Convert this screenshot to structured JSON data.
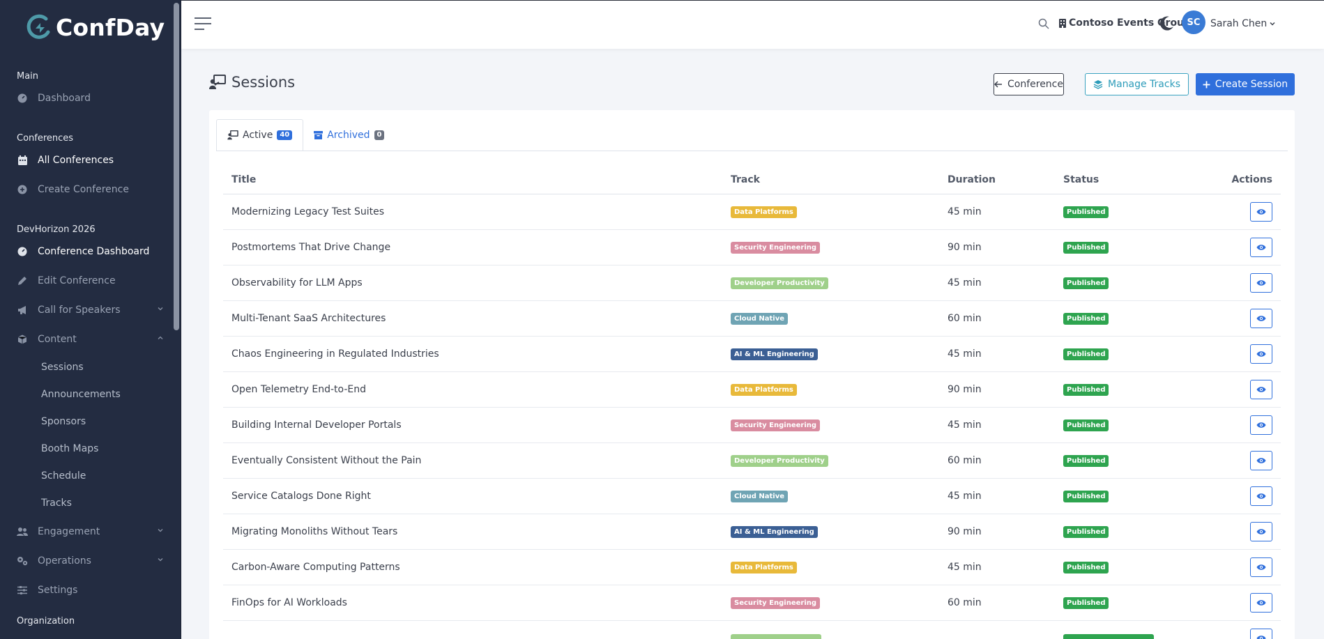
{
  "brand": {
    "name": "ConfDay"
  },
  "header": {
    "org_name": "Contoso Events Group",
    "user_initials": "SC",
    "user_name": "Sarah Chen"
  },
  "sidebar": {
    "sections": {
      "main": "Main",
      "conferences": "Conferences",
      "conference_name": "DevHorizon 2026",
      "organization": "Organization"
    },
    "items": {
      "dashboard": "Dashboard",
      "all_conferences": "All Conferences",
      "create_conference": "Create Conference",
      "conference_dashboard": "Conference Dashboard",
      "edit_conference": "Edit Conference",
      "call_for_speakers": "Call for Speakers",
      "content": "Content",
      "engagement": "Engagement",
      "operations": "Operations",
      "settings": "Settings"
    },
    "content_sub": {
      "sessions": "Sessions",
      "announcements": "Announcements",
      "sponsors": "Sponsors",
      "booth_maps": "Booth Maps",
      "schedule": "Schedule",
      "tracks": "Tracks"
    }
  },
  "page": {
    "title": "Sessions",
    "buttons": {
      "conference": "Conference",
      "manage_tracks": "Manage Tracks",
      "create_session": "Create Session"
    },
    "tabs": {
      "active_label": "Active",
      "active_count": "40",
      "archived_label": "Archived",
      "archived_count": "0"
    },
    "table": {
      "headers": {
        "title": "Title",
        "track": "Track",
        "duration": "Duration",
        "status": "Status",
        "actions": "Actions"
      },
      "rows": [
        {
          "title": "Modernizing Legacy Test Suites",
          "track": "Data Platforms",
          "duration": "45 min",
          "status": "Published"
        },
        {
          "title": "Postmortems That Drive Change",
          "track": "Security Engineering",
          "duration": "90 min",
          "status": "Published"
        },
        {
          "title": "Observability for LLM Apps",
          "track": "Developer Productivity",
          "duration": "45 min",
          "status": "Published"
        },
        {
          "title": "Multi-Tenant SaaS Architectures",
          "track": "Cloud Native",
          "duration": "60 min",
          "status": "Published"
        },
        {
          "title": "Chaos Engineering in Regulated Industries",
          "track": "AI & ML Engineering",
          "duration": "45 min",
          "status": "Published"
        },
        {
          "title": "Open Telemetry End-to-End",
          "track": "Data Platforms",
          "duration": "90 min",
          "status": "Published"
        },
        {
          "title": "Building Internal Developer Portals",
          "track": "Security Engineering",
          "duration": "45 min",
          "status": "Published"
        },
        {
          "title": "Eventually Consistent Without the Pain",
          "track": "Developer Productivity",
          "duration": "60 min",
          "status": "Published"
        },
        {
          "title": "Service Catalogs Done Right",
          "track": "Cloud Native",
          "duration": "45 min",
          "status": "Published"
        },
        {
          "title": "Migrating Monoliths Without Tears",
          "track": "AI & ML Engineering",
          "duration": "90 min",
          "status": "Published"
        },
        {
          "title": "Carbon-Aware Computing Patterns",
          "track": "Data Platforms",
          "duration": "45 min",
          "status": "Published"
        },
        {
          "title": "FinOps for AI Workloads",
          "track": "Security Engineering",
          "duration": "60 min",
          "status": "Published"
        },
        {
          "title": "",
          "track": "",
          "duration": "",
          "status": ""
        }
      ]
    }
  },
  "colors": {
    "track_colors": {
      "Data Platforms": "#e8b93a",
      "Security Engineering": "#d98ca0",
      "Developer Productivity": "#9fd08a",
      "Cloud Native": "#6fa4b4",
      "AI & ML Engineering": "#3b5f94"
    },
    "accent": "#2f6fdc",
    "sidebar_bg": "#232c41"
  }
}
